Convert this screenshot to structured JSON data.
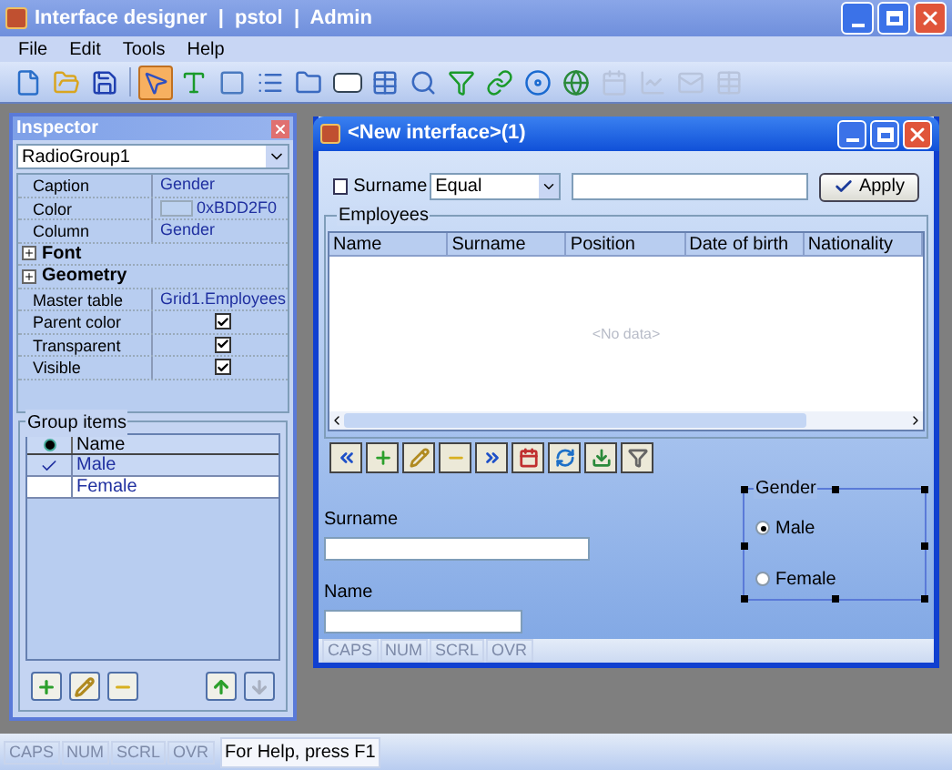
{
  "window": {
    "title": "Interface designer  |  pstol  |  Admin"
  },
  "menu": [
    "File",
    "Edit",
    "Tools",
    "Help"
  ],
  "toolbar": [
    {
      "kind": "new",
      "selected": false,
      "disabled": false
    },
    {
      "kind": "open",
      "selected": false,
      "disabled": false
    },
    {
      "kind": "save",
      "selected": false,
      "disabled": false
    },
    {
      "kind": "pointer",
      "selected": true,
      "disabled": false
    },
    {
      "kind": "label",
      "selected": false,
      "disabled": false
    },
    {
      "kind": "panel",
      "selected": false,
      "disabled": false
    },
    {
      "kind": "list",
      "selected": false,
      "disabled": false
    },
    {
      "kind": "tabs",
      "selected": false,
      "disabled": false
    },
    {
      "kind": "okbutton",
      "selected": false,
      "disabled": false
    },
    {
      "kind": "grid",
      "selected": false,
      "disabled": false
    },
    {
      "kind": "search",
      "selected": false,
      "disabled": false
    },
    {
      "kind": "filter",
      "selected": false,
      "disabled": false
    },
    {
      "kind": "link",
      "selected": false,
      "disabled": false
    },
    {
      "kind": "media",
      "selected": false,
      "disabled": false
    },
    {
      "kind": "globe",
      "selected": false,
      "disabled": false
    },
    {
      "kind": "calendar",
      "selected": false,
      "disabled": true
    },
    {
      "kind": "chart",
      "selected": false,
      "disabled": true
    },
    {
      "kind": "mail",
      "selected": false,
      "disabled": true
    },
    {
      "kind": "grid",
      "selected": false,
      "disabled": true
    }
  ],
  "inspector": {
    "title": "Inspector",
    "object": "RadioGroup1",
    "properties": [
      {
        "kind": "text",
        "name": "Caption",
        "value": "Gender"
      },
      {
        "kind": "color",
        "name": "Color",
        "value": "0xBDD2F0",
        "color": "#bdd2f0"
      },
      {
        "kind": "text",
        "name": "Column",
        "value": "Gender"
      },
      {
        "kind": "group",
        "name": "Font",
        "expanded": false
      },
      {
        "kind": "group",
        "name": "Geometry",
        "expanded": false
      },
      {
        "kind": "text",
        "name": "Master table",
        "value": "Grid1.Employees"
      },
      {
        "kind": "check",
        "name": "Parent color",
        "checked": true
      },
      {
        "kind": "check",
        "name": "Transparent",
        "checked": true
      },
      {
        "kind": "check",
        "name": "Visible",
        "checked": true
      }
    ],
    "group_items": {
      "title": "Group items",
      "column": "Name",
      "rows": [
        {
          "name": "Male",
          "checked": true,
          "selected": false
        },
        {
          "name": "Female",
          "checked": false,
          "selected": true
        }
      ],
      "buttons": [
        {
          "kind": "add",
          "disabled": false
        },
        {
          "kind": "edit",
          "disabled": false
        },
        {
          "kind": "delete",
          "disabled": false
        },
        {
          "kind": "up",
          "disabled": false
        },
        {
          "kind": "down",
          "disabled": true
        }
      ]
    }
  },
  "form": {
    "title": "<New interface>(1)",
    "filter": {
      "label": "Surname",
      "checked": false,
      "operator": "Equal",
      "apply": "Apply"
    },
    "employees": {
      "title": "Employees",
      "columns": [
        "Name",
        "Surname",
        "Position",
        "Date of birth",
        "Nationality"
      ],
      "empty": "<No data>",
      "nav": [
        {
          "kind": "first"
        },
        {
          "kind": "add"
        },
        {
          "kind": "edit"
        },
        {
          "kind": "delete"
        },
        {
          "kind": "last"
        },
        {
          "kind": "calendar"
        },
        {
          "kind": "refresh"
        },
        {
          "kind": "export"
        },
        {
          "kind": "filter"
        }
      ]
    },
    "fields": [
      {
        "label": "Surname"
      },
      {
        "label": "Name"
      }
    ],
    "gender": {
      "title": "Gender",
      "options": [
        {
          "label": "Male",
          "selected": true
        },
        {
          "label": "Female",
          "selected": false
        }
      ]
    },
    "status": [
      {
        "label": "CAPS",
        "disabled": true
      },
      {
        "label": "NUM",
        "disabled": true
      },
      {
        "label": "SCRL",
        "disabled": true
      },
      {
        "label": "OVR",
        "disabled": true
      }
    ]
  },
  "status_bar": {
    "indicators": [
      {
        "label": "CAPS",
        "disabled": true
      },
      {
        "label": "NUM",
        "disabled": true
      },
      {
        "label": "SCRL",
        "disabled": true
      },
      {
        "label": "OVR",
        "disabled": true
      }
    ],
    "message": "For Help, press F1"
  }
}
